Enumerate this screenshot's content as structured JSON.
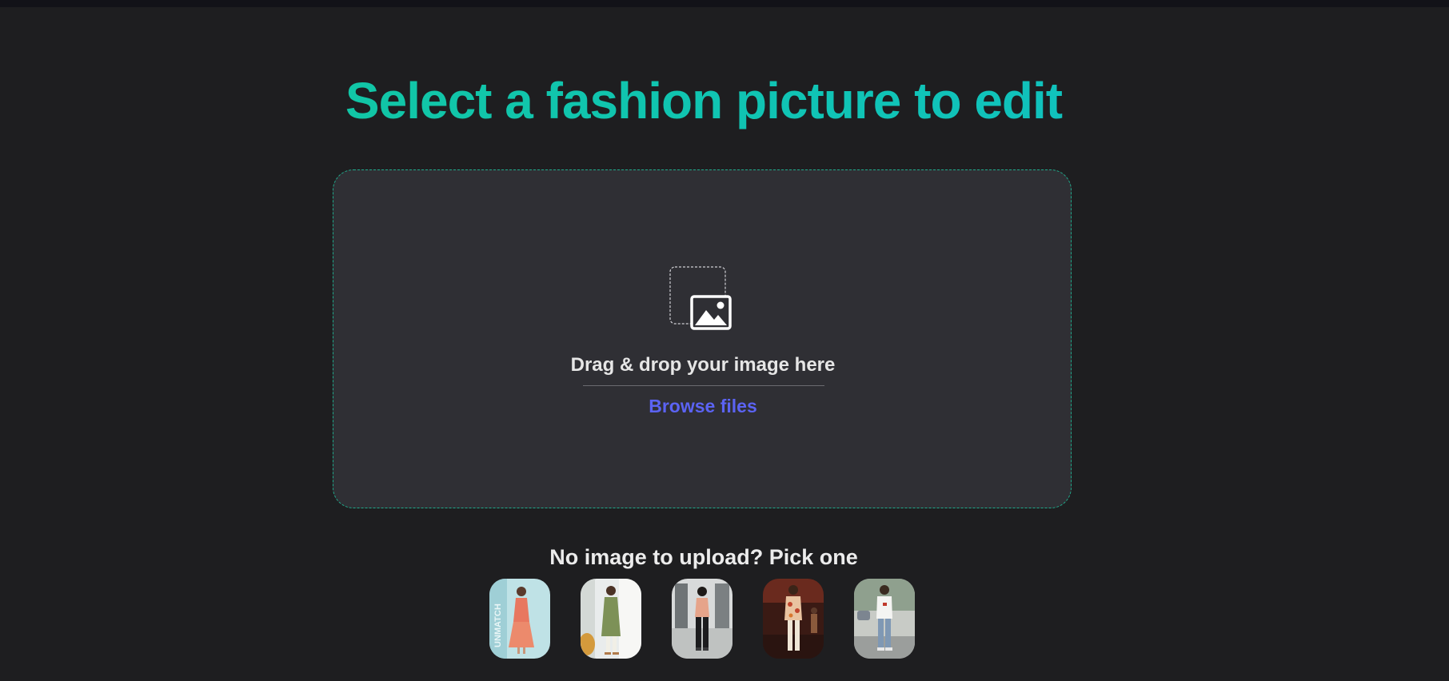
{
  "page": {
    "title": "Select a fashion picture to edit"
  },
  "dropzone": {
    "icon": "image-icon",
    "instruction": "Drag & drop your image here",
    "browse_label": "Browse files"
  },
  "samples": {
    "heading": "No image to upload? Pick one",
    "items": [
      {
        "icon": "sample-photo-woman-coral-dress",
        "overlay_text": "UNMATCH"
      },
      {
        "icon": "sample-photo-man-green-kurta"
      },
      {
        "icon": "sample-photo-woman-peach-top"
      },
      {
        "icon": "sample-photo-man-floral-shirt"
      },
      {
        "icon": "sample-photo-man-white-tshirt"
      }
    ]
  },
  "colors": {
    "background": "#1e1e20",
    "dropzone": "#2f2f34",
    "accent_green": "#12c79a",
    "link_blue": "#5b63f3"
  }
}
